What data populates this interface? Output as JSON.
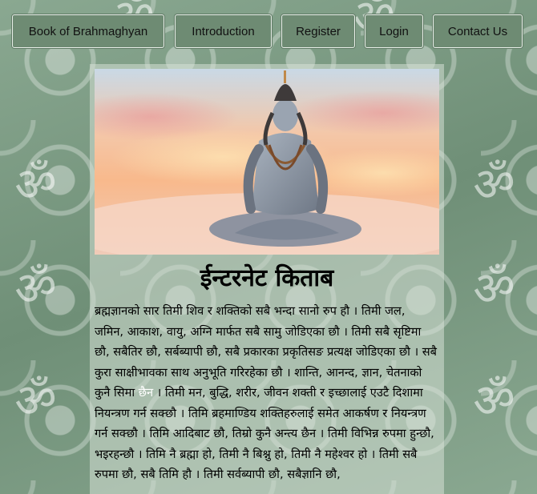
{
  "nav": {
    "items": [
      {
        "label": "Book of Brahmaghyan"
      },
      {
        "label": "Introduction"
      },
      {
        "label": "Register"
      },
      {
        "label": "Login"
      },
      {
        "label": "Contact Us"
      }
    ]
  },
  "background": {
    "symbol": "ॐ"
  },
  "hero": {
    "image": "meditating-shiva-image"
  },
  "main": {
    "title": "ईन्टरनेट किताब",
    "paragraph_before": "ब्रह्मज्ञानको सार तिमी शिव र शक्तिको सबै भन्दा सानो रुप हौ । तिमी जल, जमिन, आकाश, वायु, अग्नि मार्फत सबै सामु जोडिएका छौ । तिमी सबै सृष्टिमा छौ, सबैतिर छौ, सर्बब्यापी छौ, सबै प्रकारका प्रकृतिसङ प्रत्यक्ष जोडिएका छौ । सबै कुरा साक्षीभावका साथ अनुभूति गरिरहेका छौ । शान्ति, आनन्द, ज्ञान, चेतनाको कुनै सिमा ",
    "paragraph_highlight": "छैन",
    "paragraph_after": " । तिमी मन, बुद्धि, शरीर, जीवन शक्ती र इच्छालाई एउटै दिशामा नियन्त्रण गर्न सक्छौ । तिमि ब्रहमाण्डिय शक्तिहरुलाई समेत आकर्षण र नियन्त्रण गर्न सक्छौ । तिमि आदिबाट छौ, तिम्रो कुनै अन्त्य छैन । तिमी विभिन्न रुपमा हुन्छौ, भइरहन्छौ । तिमि नै ब्रह्मा हो, तिमी नै बिश्नु हो, तिमी नै महेश्वर हो । तिमी सबै रुपमा छौ, सबै तिमि हौ । तिमी सर्वब्यापी छौ, सबैज्ञानि छौ,"
  },
  "colors": {
    "nav_button": "#6e8b73",
    "background": "#7f9f86",
    "highlight": "#ffffff"
  }
}
